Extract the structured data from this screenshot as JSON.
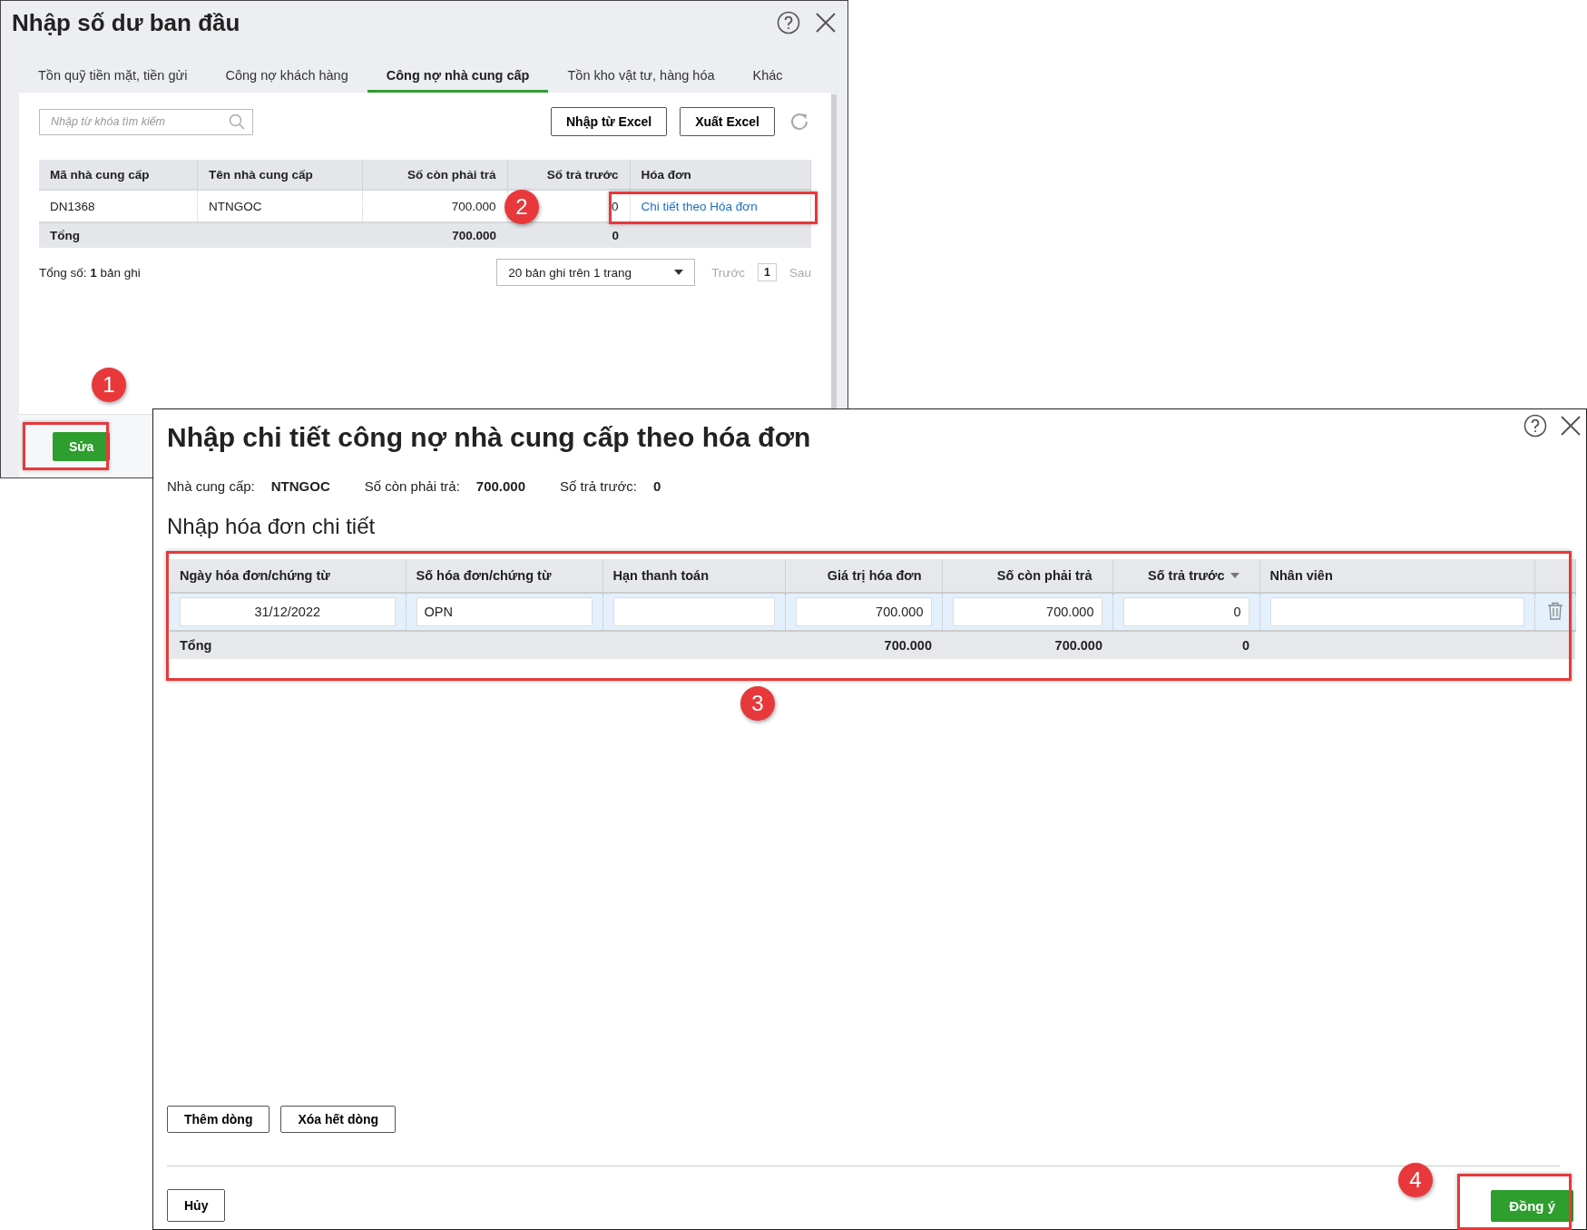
{
  "main_dialog": {
    "title": "Nhập số dư ban đầu",
    "tabs": [
      {
        "label": "Tồn quỹ tiền mặt, tiền gửi",
        "selected": false
      },
      {
        "label": "Công nợ khách hàng",
        "selected": false
      },
      {
        "label": "Công nợ nhà cung cấp",
        "selected": true
      },
      {
        "label": "Tồn kho vật tư, hàng hóa",
        "selected": false
      },
      {
        "label": "Khác",
        "selected": false
      }
    ],
    "search": {
      "placeholder": "Nhập từ khóa tìm kiếm"
    },
    "buttons": [
      "Nhập từ Excel",
      "Xuất Excel"
    ],
    "table": {
      "columns": [
        "Mã nhà cung cấp",
        "Tên nhà cung cấp",
        "Số còn phải trả",
        "Số trả trước",
        "Hóa đơn"
      ],
      "rows": [
        {
          "code": "DN1368",
          "name": "NTNGOC",
          "payable": "700.000",
          "prepaid": "0",
          "link": "Chi tiết theo Hóa đơn"
        }
      ],
      "total": {
        "label": "Tổng",
        "amounts": [
          "700.000",
          "0"
        ]
      }
    },
    "record_count": "Tổng số: **1** bản ghi",
    "page_size": "20 bản ghi trên 1 trang",
    "pager": [
      {
        "label": "Trước",
        "kind": "link",
        "disabled": true
      },
      {
        "label": "1",
        "kind": "page"
      },
      {
        "label": "Sau",
        "kind": "link",
        "disabled": true
      }
    ],
    "edit_button": "Sửa"
  },
  "detail_dialog": {
    "title": "Nhập chi tiết công nợ nhà cung cấp theo hóa đơn",
    "info": [
      {
        "label": "Nhà cung cấp:",
        "value": "NTNGOC"
      },
      {
        "label": "Số còn phải trả:",
        "value": "700.000"
      },
      {
        "label": "Số trả trước:",
        "value": "0"
      }
    ],
    "section_title": "Nhập hóa đơn chi tiết",
    "table": {
      "columns": [
        {
          "label": "Ngày hóa đơn/chứng từ",
          "sorted": false
        },
        {
          "label": "Số hóa đơn/chứng từ",
          "sorted": false
        },
        {
          "label": "Hạn thanh toán",
          "sorted": false
        },
        {
          "label": "Giá trị hóa đơn",
          "sorted": false
        },
        {
          "label": "Số còn phải trả",
          "sorted": false
        },
        {
          "label": "Số trả trước",
          "sorted": true
        },
        {
          "label": "Nhân viên",
          "sorted": false
        }
      ],
      "rows": [
        {
          "date": "31/12/2022",
          "number": "OPN",
          "amount": "700.000",
          "remaining": "700.000",
          "prepaid": "0"
        }
      ],
      "total": {
        "label": "Tổng",
        "amounts": [
          "700.000",
          "700.000",
          "0"
        ]
      }
    },
    "row_buttons": [
      "Thêm dòng",
      "Xóa hết dòng"
    ],
    "cancel": "Hủy",
    "confirm": "Đồng ý"
  },
  "annotations": [
    "1",
    "2",
    "3",
    "4"
  ]
}
